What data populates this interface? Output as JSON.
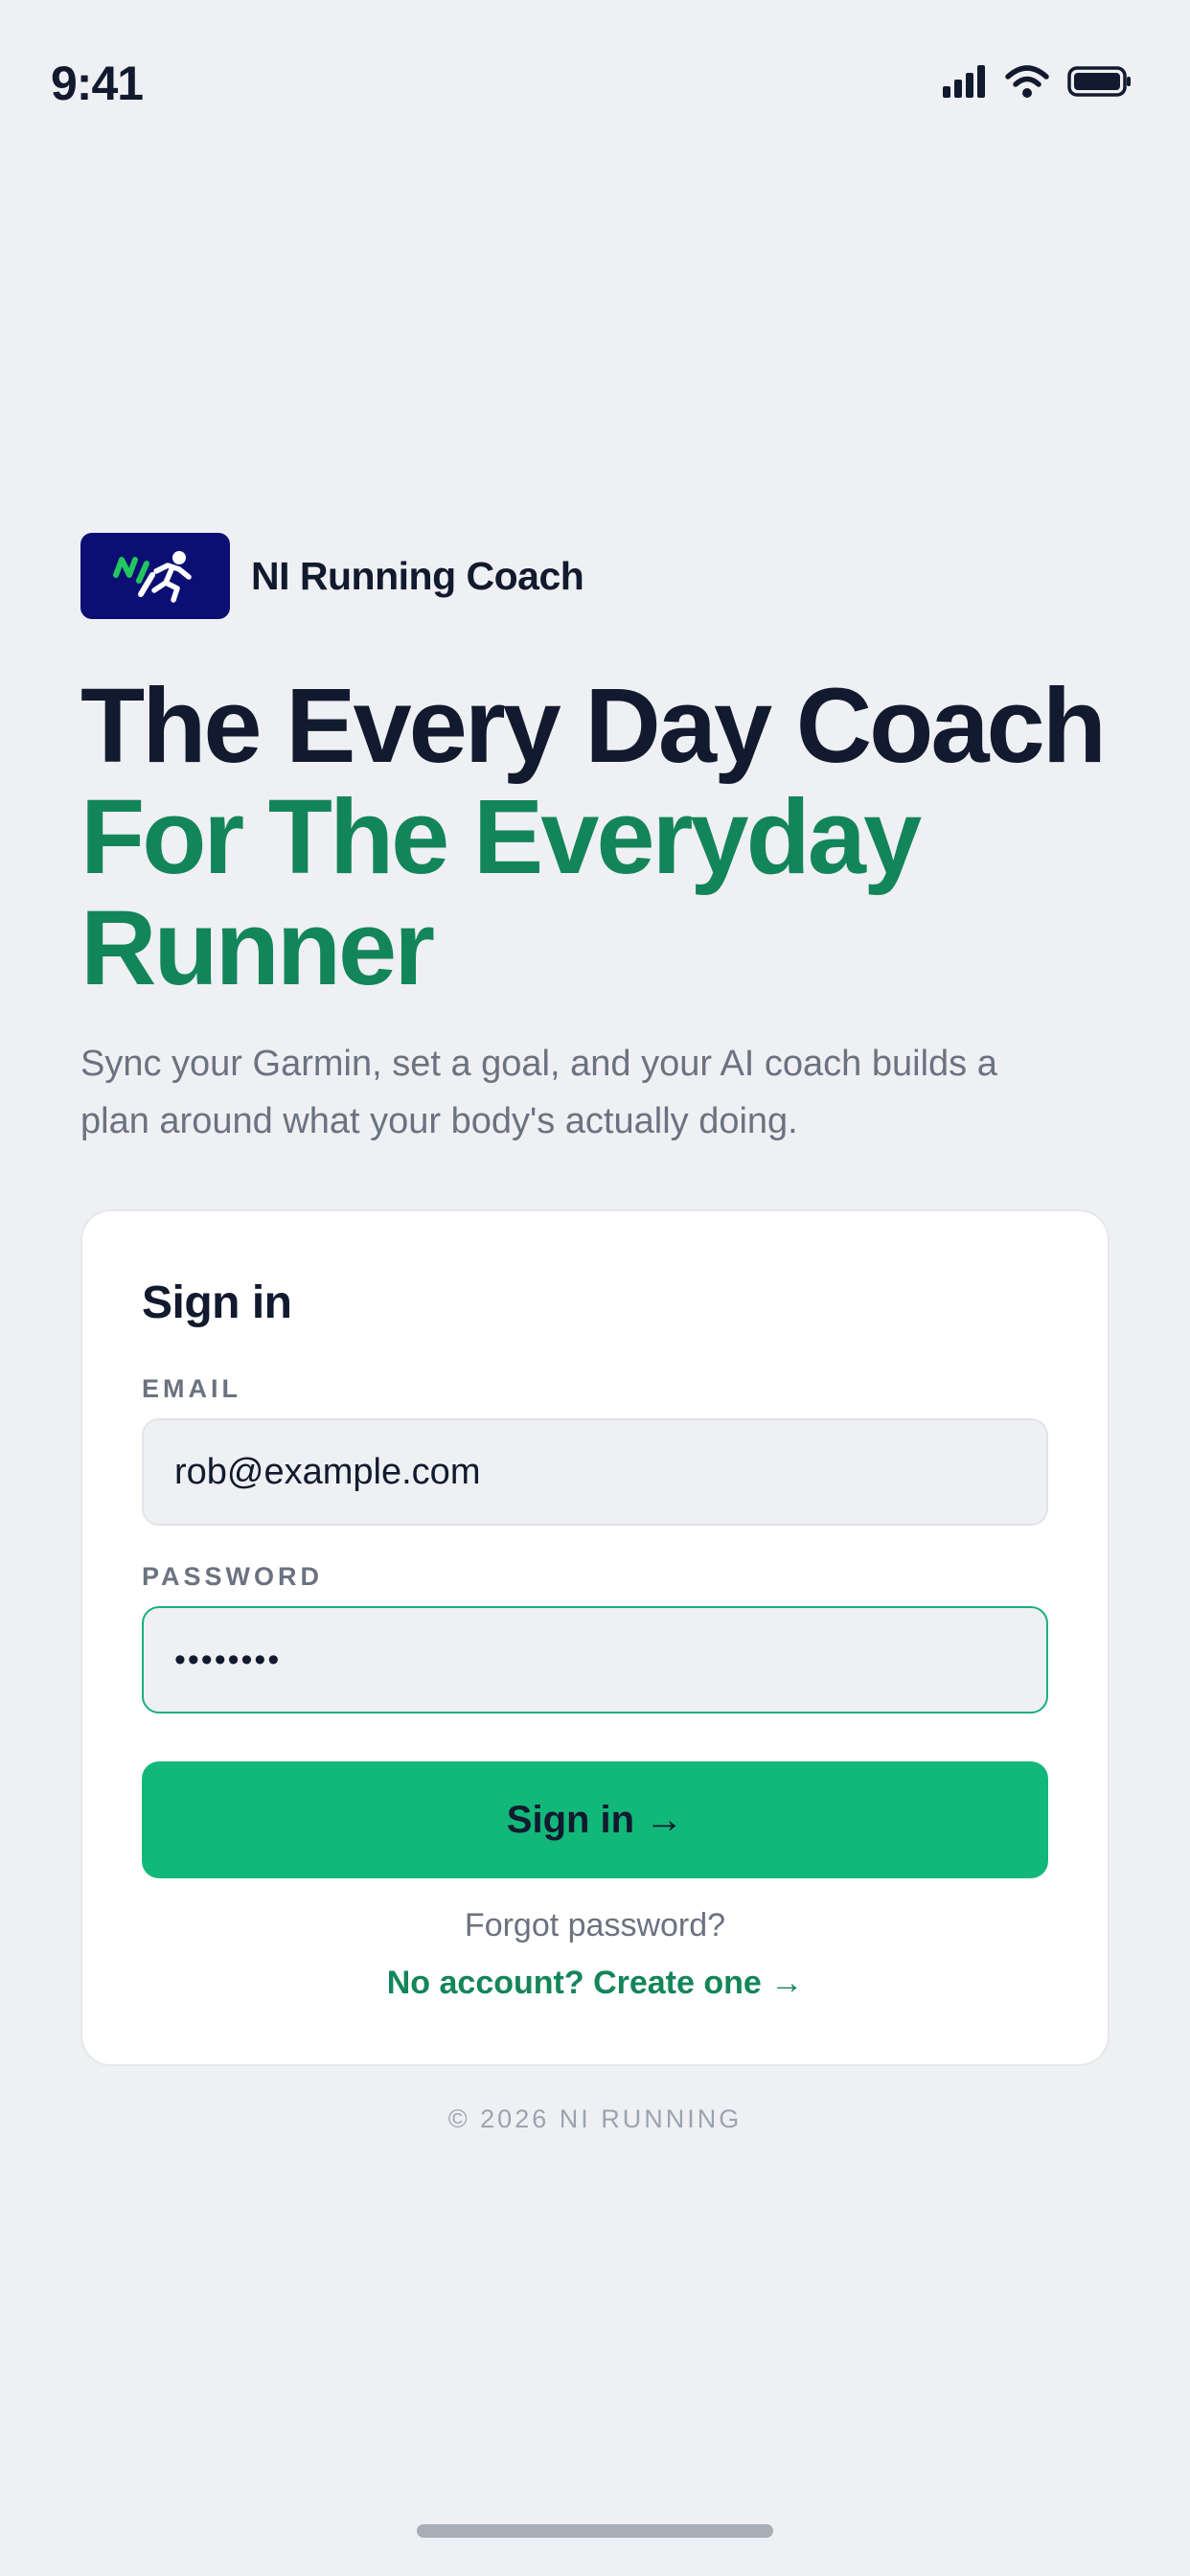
{
  "status_bar": {
    "time": "9:41",
    "icons": [
      "signal-icon",
      "wifi-icon",
      "battery-icon"
    ]
  },
  "brand": {
    "logo_icon": "runner-logo-icon",
    "name": "NI Running Coach",
    "logo_bg": "#0b0f74",
    "logo_accent": "#22c55e"
  },
  "hero": {
    "line1": "The Every Day Coach",
    "line2": "For The Everyday",
    "line3": "Runner"
  },
  "tagline": {
    "line1": "Sync your Garmin, set a goal, and your AI coach builds a",
    "line2": "plan around what your body's actually doing."
  },
  "signin": {
    "title": "Sign in",
    "email_label": "EMAIL",
    "email_value": "rob@example.com",
    "password_label": "PASSWORD",
    "password_value": "••••••••",
    "submit_label": "Sign in →",
    "forgot_label": "Forgot password?",
    "create_label": "No account? Create one →"
  },
  "footer": {
    "copyright": "© 2026 NI RUNNING"
  },
  "colors": {
    "background": "#eff0f3",
    "text_dark": "#111a2e",
    "accent_green": "#13855a",
    "button_green": "#12b879",
    "muted": "#6b7280"
  }
}
